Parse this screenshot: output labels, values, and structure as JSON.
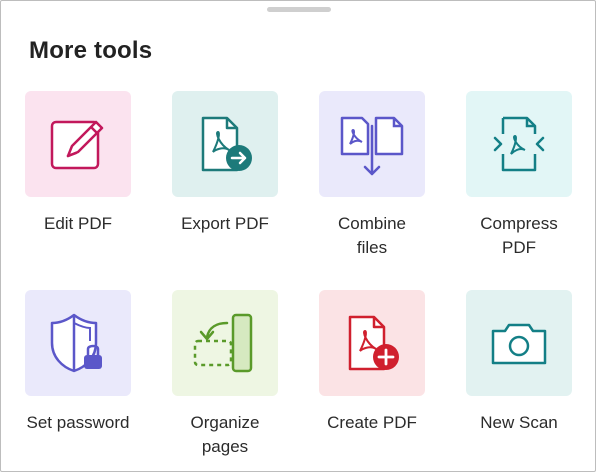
{
  "header": {
    "title": "More tools"
  },
  "tools": [
    {
      "label": "Edit PDF",
      "icon": "pencil-edit-icon",
      "tile_color": "#fbe3ef"
    },
    {
      "label": "Export PDF",
      "icon": "pdf-export-icon",
      "tile_color": "#dff0ef"
    },
    {
      "label": "Combine\nfiles",
      "icon": "combine-files-icon",
      "tile_color": "#eae9fb"
    },
    {
      "label": "Compress\nPDF",
      "icon": "compress-pdf-icon",
      "tile_color": "#e2f6f6"
    },
    {
      "label": "Set password",
      "icon": "shield-lock-icon",
      "tile_color": "#eae9fb"
    },
    {
      "label": "Organize\npages",
      "icon": "organize-pages-icon",
      "tile_color": "#eef6e3"
    },
    {
      "label": "Create PDF",
      "icon": "pdf-create-icon",
      "tile_color": "#fbe3e5"
    },
    {
      "label": "New Scan",
      "icon": "camera-icon",
      "tile_color": "#e2f2f1"
    }
  ]
}
